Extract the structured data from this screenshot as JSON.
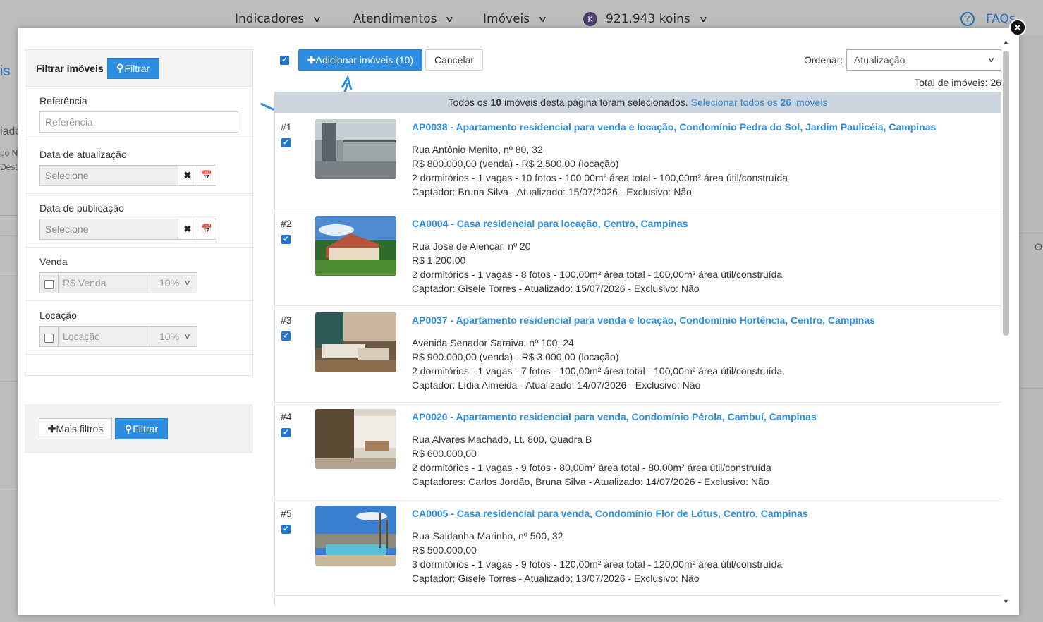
{
  "nav": {
    "items": [
      {
        "label": "Indicadores"
      },
      {
        "label": "Atendimentos"
      },
      {
        "label": "Imóveis"
      },
      {
        "label": "921.943 koins"
      }
    ],
    "koins_badge": "K",
    "faq": "FAQs"
  },
  "background": {
    "frag1": "is",
    "frag2": "iado",
    "frag3": "po N",
    "frag4": "Desta",
    "frag5": "O"
  },
  "filters": {
    "title": "Filtrar imóveis",
    "filter_button": "Filtrar",
    "reference": {
      "label": "Referência",
      "placeholder": "Referência"
    },
    "updated": {
      "label": "Data de atualização",
      "placeholder": "Selecione"
    },
    "published": {
      "label": "Data de publicação",
      "placeholder": "Selecione"
    },
    "sale": {
      "label": "Venda",
      "placeholder": "R$ Venda",
      "percent": "10%"
    },
    "rent": {
      "label": "Locação",
      "placeholder": "Locação",
      "percent": "10%"
    },
    "more_filters": "Mais filtros",
    "filter_button_bottom": "Filtrar"
  },
  "toolbar": {
    "add_label": "Adicionar imóveis (10)",
    "cancel_label": "Cancelar",
    "sort_label": "Ordenar:",
    "sort_value": "Atualização",
    "total_label": "Total de imóveis: 26"
  },
  "banner": {
    "text_before": "Todos os ",
    "count_bold": "10",
    "text_after": " imóveis desta página foram selecionados.",
    "link_before": "Selecionar todos os ",
    "link_count": "26",
    "link_after": " imóveis"
  },
  "properties": [
    {
      "num": "#1",
      "title": "AP0038 - Apartamento residencial para venda e locação, Condomínio Pedra do Sol, Jardim Paulicéia, Campinas",
      "address": "Rua Antônio Menito, nº 80, 32",
      "price": "R$ 800.000,00 (venda) - R$ 2.500,00 (locação)",
      "details": "2 dormitórios - 1 vagas - 10 fotos - 100,00m² área total - 100,00m² área útil/construída",
      "agent": "Captador: Bruna Silva - Atualizado: 15/07/2026 - Exclusivo: Não"
    },
    {
      "num": "#2",
      "title": "CA0004 - Casa residencial para locação, Centro, Campinas",
      "address": "Rua José de Alencar, nº 20",
      "price": "R$ 1.200,00",
      "details": "2 dormitórios - 1 vagas - 8 fotos - 100,00m² área total - 100,00m² área útil/construída",
      "agent": "Captador: Gisele Torres - Atualizado: 15/07/2026 - Exclusivo: Não"
    },
    {
      "num": "#3",
      "title": "AP0037 - Apartamento residencial para venda e locação, Condomínio Hortência, Centro, Campinas",
      "address": "Avenida Senador Saraiva, nº 100, 24",
      "price": "R$ 900.000,00 (venda) - R$ 3.000,00 (locação)",
      "details": "2 dormitórios - 1 vagas - 7 fotos - 100,00m² área total - 100,00m² área útil/construída",
      "agent": "Captador: Lídia Almeida - Atualizado: 14/07/2026 - Exclusivo: Não"
    },
    {
      "num": "#4",
      "title": "AP0020 - Apartamento residencial para venda, Condomínio Pérola, Cambuí, Campinas",
      "address": "Rua Alvares Machado, Lt. 800, Quadra B",
      "price": "R$ 600.000,00",
      "details": "2 dormitórios - 1 vagas - 9 fotos - 80,00m² área total - 80,00m² área útil/construída",
      "agent": "Captadores: Carlos Jordão, Bruna Silva - Atualizado: 14/07/2026 - Exclusivo: Não"
    },
    {
      "num": "#5",
      "title": "CA0005 - Casa residencial para venda, Condomínio Flor de Lótus, Centro, Campinas",
      "address": "Rua Saldanha Marinho, nº 500, 32",
      "price": "R$ 500.000,00",
      "details": "3 dormitórios - 1 vagas - 9 fotos - 120,00m² área total - 120,00m² área útil/construída",
      "agent": "Captador: Gisele Torres - Atualizado: 13/07/2026 - Exclusivo: Não"
    }
  ],
  "colors": {
    "primary": "#2d8de0",
    "banner": "#cfd5dc",
    "checkbox": "#1f74d6"
  }
}
